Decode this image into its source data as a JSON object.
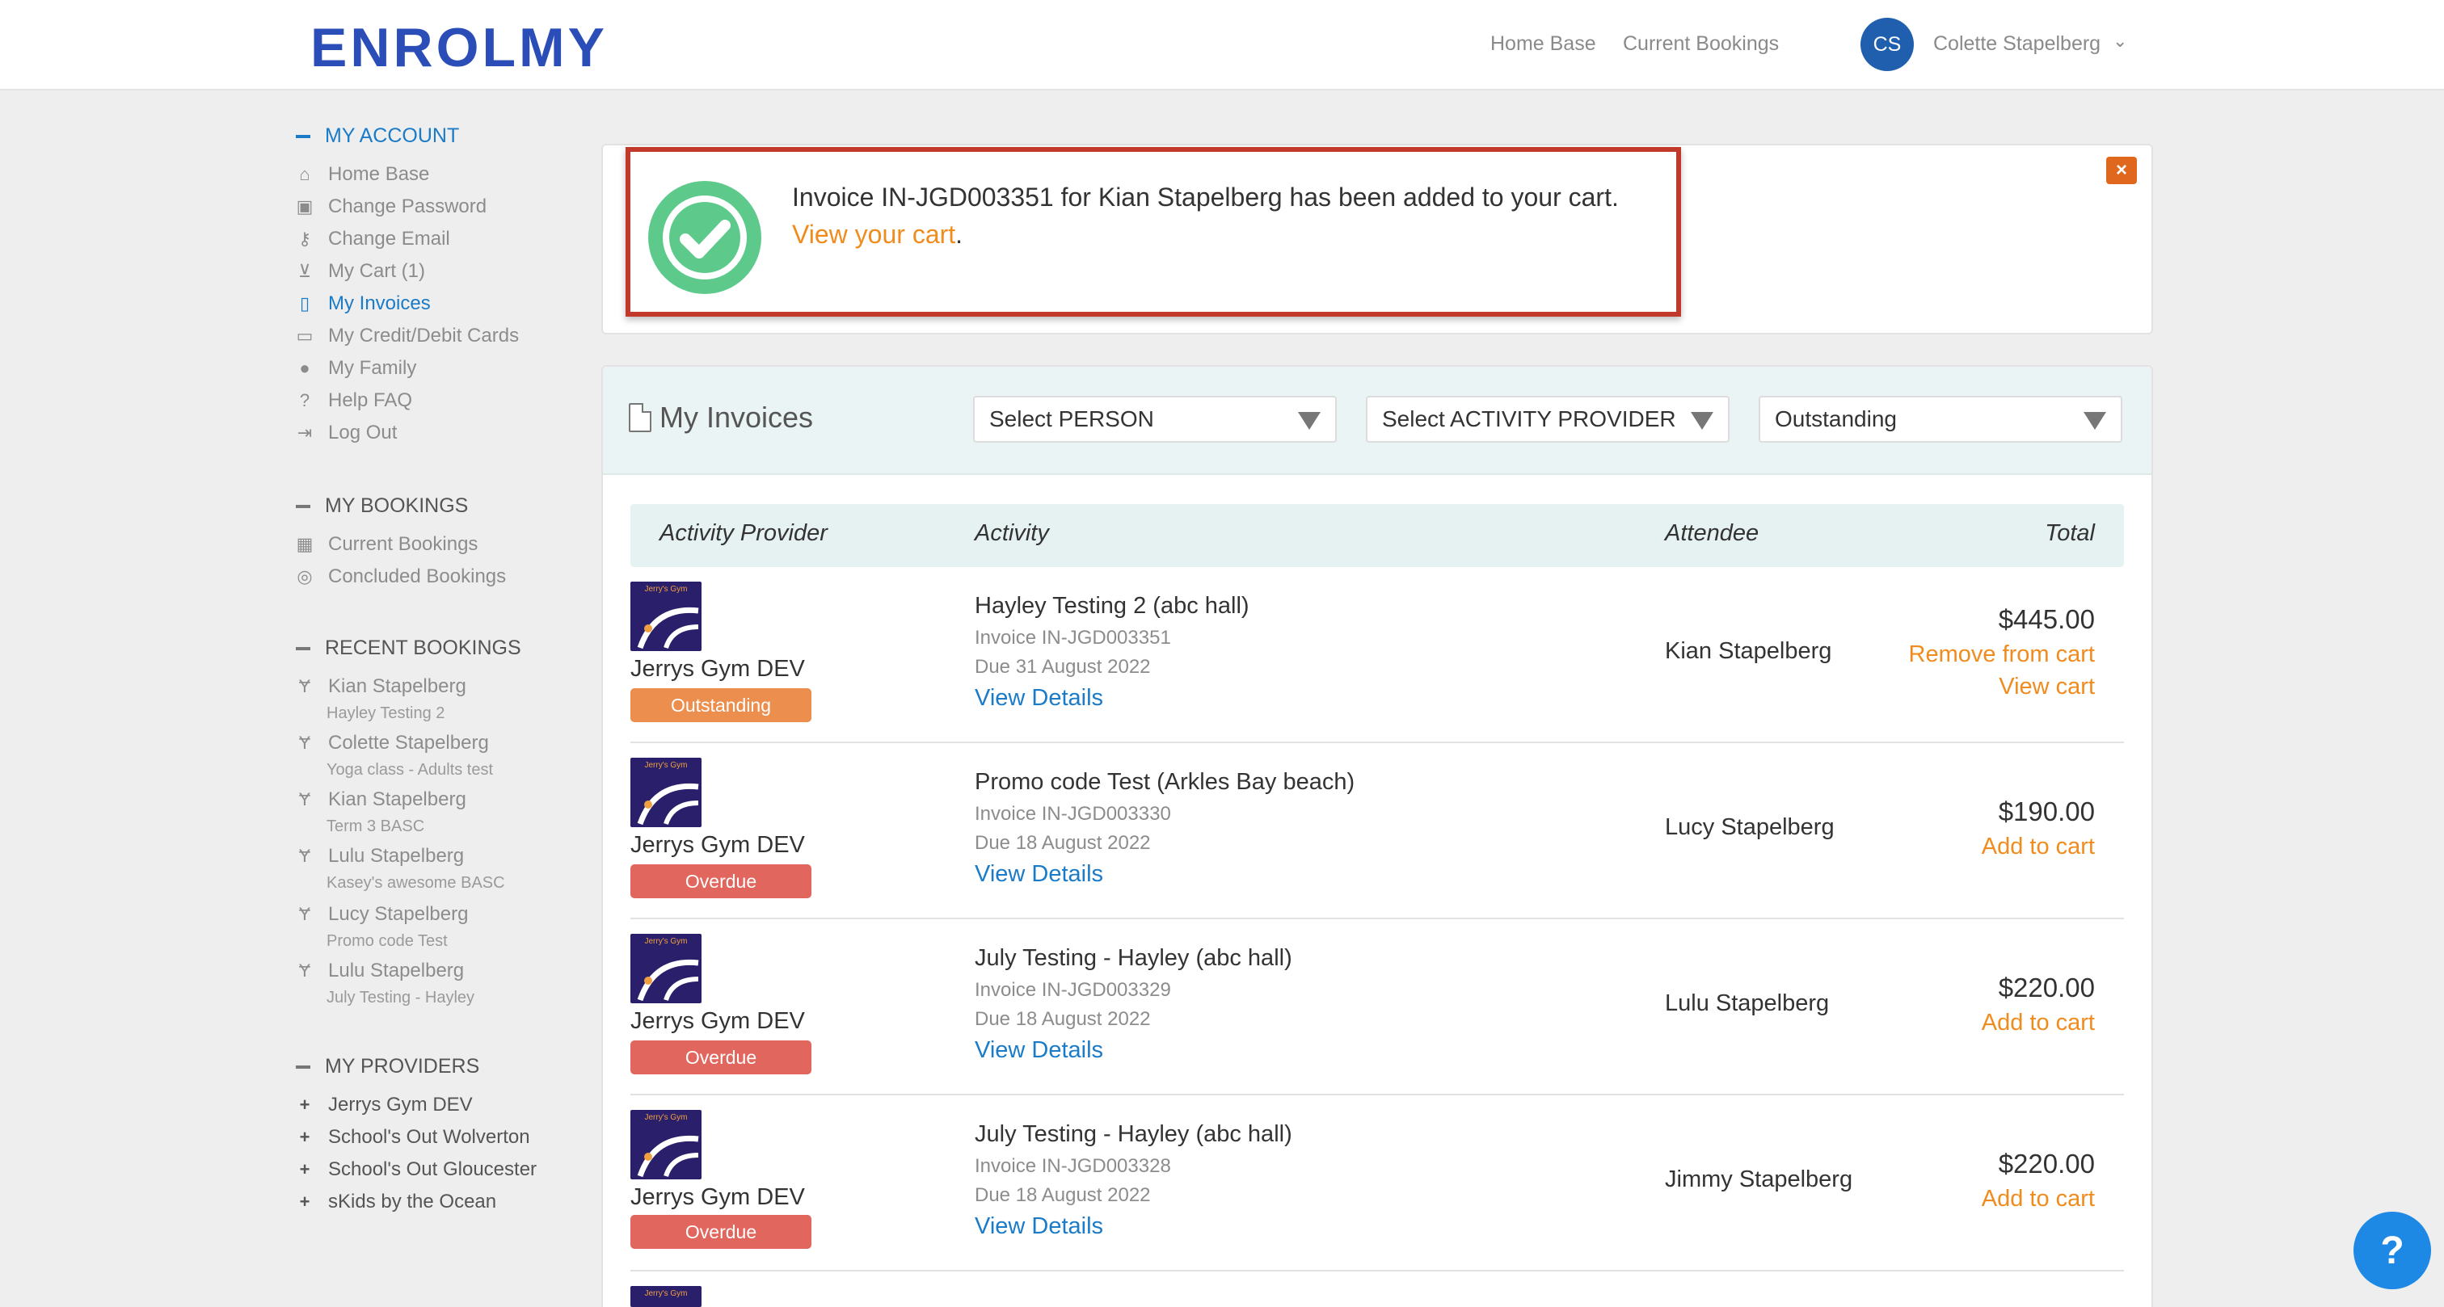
{
  "header": {
    "logo": "ENROLMY",
    "nav": [
      "Home Base",
      "Current Bookings"
    ],
    "user_initials": "CS",
    "user_name": "Colette Stapelberg"
  },
  "sidebar": {
    "account_heading": "MY ACCOUNT",
    "account_items": [
      {
        "label": "Home Base",
        "icon": "home-icon"
      },
      {
        "label": "Change Password",
        "icon": "lock-icon"
      },
      {
        "label": "Change Email",
        "icon": "key-icon"
      },
      {
        "label": "My Cart (1)",
        "icon": "cart-icon"
      },
      {
        "label": "My Invoices",
        "icon": "document-icon"
      },
      {
        "label": "My Credit/Debit Cards",
        "icon": "credit-card-icon"
      },
      {
        "label": "My Family",
        "icon": "family-icon"
      },
      {
        "label": "Help FAQ",
        "icon": "question-icon"
      },
      {
        "label": "Log Out",
        "icon": "logout-icon"
      }
    ],
    "bookings_heading": "MY BOOKINGS",
    "bookings_items": [
      {
        "label": "Current Bookings",
        "icon": "calendar-icon"
      },
      {
        "label": "Concluded Bookings",
        "icon": "check-circle-icon"
      }
    ],
    "recent_heading": "RECENT BOOKINGS",
    "recent_items": [
      {
        "name": "Kian Stapelberg",
        "activity": "Hayley Testing 2"
      },
      {
        "name": "Colette Stapelberg",
        "activity": "Yoga class - Adults test"
      },
      {
        "name": "Kian Stapelberg",
        "activity": "Term 3 BASC"
      },
      {
        "name": "Lulu Stapelberg",
        "activity": "Kasey's awesome BASC"
      },
      {
        "name": "Lucy Stapelberg",
        "activity": "Promo code Test"
      },
      {
        "name": "Lulu Stapelberg",
        "activity": "July Testing - Hayley"
      }
    ],
    "providers_heading": "MY PROVIDERS",
    "providers_items": [
      "Jerrys Gym DEV",
      "School's Out Wolverton",
      "School's Out Gloucester",
      "sKids by the Ocean"
    ]
  },
  "alert": {
    "message": "Invoice IN-JGD003351 for Kian Stapelberg has been added to your cart.",
    "link_text": "View your cart",
    "link_suffix": ".",
    "close_label": "×"
  },
  "invoices": {
    "title": "My Invoices",
    "filters": [
      "Select PERSON",
      "Select ACTIVITY PROVIDER",
      "Outstanding"
    ],
    "columns": [
      "Activity Provider",
      "Activity",
      "Attendee",
      "Total"
    ],
    "logo_text": "Jerry's Gym",
    "rows": [
      {
        "provider": "Jerrys Gym DEV",
        "status": "Outstanding",
        "activity": "Hayley Testing 2 (abc hall)",
        "invoice": "Invoice IN-JGD003351",
        "due": "Due 31 August 2022",
        "details": "View Details",
        "attendee": "Kian Stapelberg",
        "amount": "$445.00",
        "action1": "Remove from cart",
        "action2": "View cart"
      },
      {
        "provider": "Jerrys Gym DEV",
        "status": "Overdue",
        "activity": "Promo code Test (Arkles Bay beach)",
        "invoice": "Invoice IN-JGD003330",
        "due": "Due 18 August 2022",
        "details": "View Details",
        "attendee": "Lucy Stapelberg",
        "amount": "$190.00",
        "action1": "Add to cart"
      },
      {
        "provider": "Jerrys Gym DEV",
        "status": "Overdue",
        "activity": "July Testing - Hayley (abc hall)",
        "invoice": "Invoice IN-JGD003329",
        "due": "Due 18 August 2022",
        "details": "View Details",
        "attendee": "Lulu Stapelberg",
        "amount": "$220.00",
        "action1": "Add to cart"
      },
      {
        "provider": "Jerrys Gym DEV",
        "status": "Overdue",
        "activity": "July Testing - Hayley (abc hall)",
        "invoice": "Invoice IN-JGD003328",
        "due": "Due 18 August 2022",
        "details": "View Details",
        "attendee": "Jimmy Stapelberg",
        "amount": "$220.00",
        "action1": "Add to cart"
      }
    ]
  },
  "help_label": "?",
  "colors": {
    "brand": "#2b4db8",
    "link_blue": "#1a7bc8",
    "link_orange": "#f08c1e",
    "outstanding": "#ec8e4e",
    "overdue": "#e0665e",
    "alert_border": "#c0392b",
    "success": "#5dca8c"
  }
}
